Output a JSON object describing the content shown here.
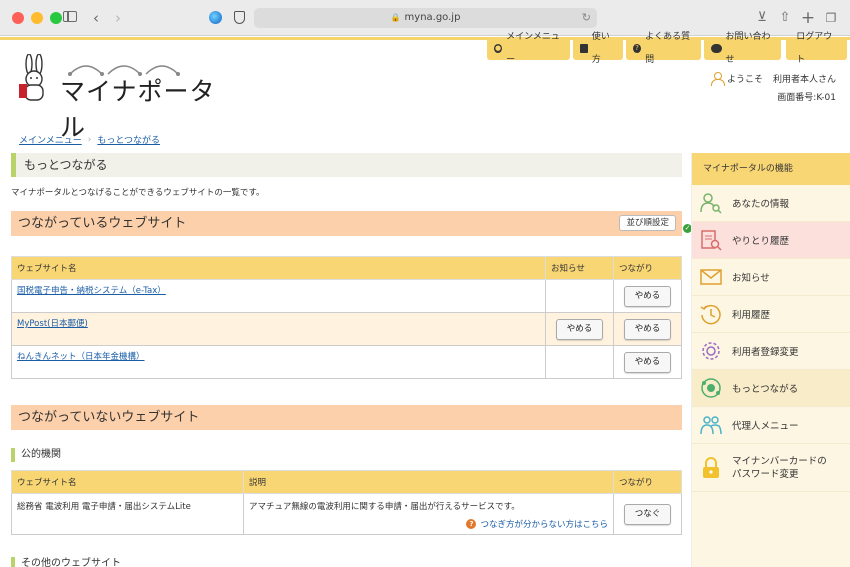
{
  "browser": {
    "url": "myna.go.jp"
  },
  "site": {
    "logo_text": "マイナポータル",
    "nav": [
      {
        "label": "メインメニュー",
        "icon": "menu-icon"
      },
      {
        "label": "使い方",
        "icon": "book-icon"
      },
      {
        "label": "よくある質問",
        "icon": "question-icon"
      },
      {
        "label": "お問い合わせ",
        "icon": "chat-icon"
      }
    ],
    "logout_label": "ログアウト",
    "welcome_label": "ようこそ",
    "user_name": "利用者本人さん",
    "screen_no": "画面番号:K-01"
  },
  "breadcrumb": {
    "home": "メインメニュー",
    "current": "もっとつながる"
  },
  "page": {
    "title": "もっとつながる",
    "intro": "マイナポータルとつなげることができるウェブサイトの一覧です。"
  },
  "connected": {
    "heading": "つながっているウェブサイト",
    "sort_label": "並び順設定",
    "columns": [
      "ウェブサイト名",
      "お知らせ",
      "つながり"
    ],
    "rows": [
      {
        "name": "国税電子申告・納税システム（e-Tax）",
        "notice": "",
        "action": "やめる"
      },
      {
        "name": "MyPost(日本郵便)",
        "notice": "やめる",
        "action": "やめる"
      },
      {
        "name": "ねんきんネット（日本年金機構）",
        "notice": "",
        "action": "やめる"
      }
    ]
  },
  "unconnected": {
    "heading": "つながっていないウェブサイト",
    "public_label": "公的機関",
    "columns": [
      "ウェブサイト名",
      "説明",
      "つながり"
    ],
    "rows": [
      {
        "name": "総務省 電波利用 電子申請・届出システムLite",
        "desc": "アマチュア無線の電波利用に関する申請・届出が行えるサービスです。",
        "action": "つなぐ"
      }
    ],
    "help_link": "つなぎ方が分からない方はこちら",
    "other_label": "その他のウェブサイト"
  },
  "sidebar": {
    "title": "マイナポータルの機能",
    "items": [
      {
        "label": "あなたの情報",
        "icon": "person-search-icon",
        "color": "#7bb26a"
      },
      {
        "label": "やりとり履歴",
        "icon": "document-search-icon",
        "color": "#d96b6b"
      },
      {
        "label": "お知らせ",
        "icon": "envelope-icon",
        "color": "#e0a030"
      },
      {
        "label": "利用履歴",
        "icon": "clock-history-icon",
        "color": "#e0a030"
      },
      {
        "label": "利用者登録変更",
        "icon": "gear-icon",
        "color": "#9b6bc4"
      },
      {
        "label": "もっとつながる",
        "icon": "connect-icon",
        "color": "#4caf6e"
      },
      {
        "label": "代理人メニュー",
        "icon": "people-icon",
        "color": "#4ab3c8"
      },
      {
        "label1": "マイナンバーカードの",
        "label2": "パスワード変更",
        "icon": "lock-icon",
        "color": "#f2c12e"
      }
    ]
  }
}
